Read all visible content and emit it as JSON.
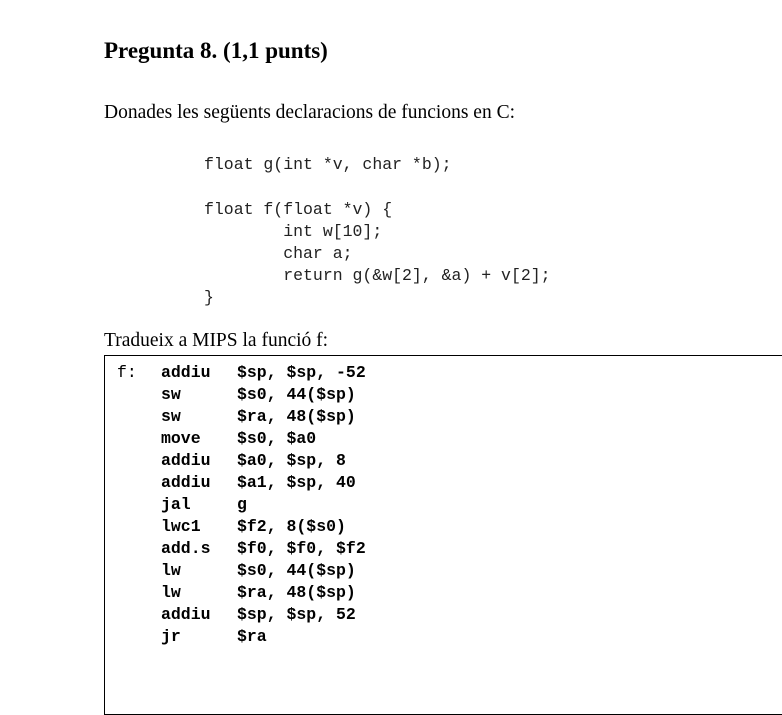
{
  "question": {
    "title": "Pregunta 8. (1,1 punts)",
    "intro": "Donades les següents declaracions de funcions en C:",
    "c_code": [
      "float g(int *v, char *b);",
      "",
      "float f(float *v) {",
      "        int w[10];",
      "        char a;",
      "        return g(&w[2], &a) + v[2];",
      "}"
    ],
    "translate_prompt": "Tradueix a MIPS la funció f:"
  },
  "answer": {
    "rows": [
      {
        "label": "f:",
        "op": "addiu",
        "args": "$sp, $sp, -52"
      },
      {
        "label": "",
        "op": "sw",
        "args": "$s0, 44($sp)"
      },
      {
        "label": "",
        "op": "sw",
        "args": "$ra, 48($sp)"
      },
      {
        "label": "",
        "op": "move",
        "args": "$s0, $a0"
      },
      {
        "label": "",
        "op": "addiu",
        "args": "$a0, $sp, 8"
      },
      {
        "label": "",
        "op": "addiu",
        "args": "$a1, $sp, 40"
      },
      {
        "label": "",
        "op": "jal",
        "args": "g"
      },
      {
        "label": "",
        "op": "lwc1",
        "args": "$f2, 8($s0)"
      },
      {
        "label": "",
        "op": "add.s",
        "args": "$f0, $f0, $f2"
      },
      {
        "label": "",
        "op": "lw",
        "args": "$s0, 44($sp)"
      },
      {
        "label": "",
        "op": "lw",
        "args": "$ra, 48($sp)"
      },
      {
        "label": "",
        "op": "addiu",
        "args": "$sp, $sp, 52"
      },
      {
        "label": "",
        "op": "jr",
        "args": "$ra"
      }
    ]
  }
}
